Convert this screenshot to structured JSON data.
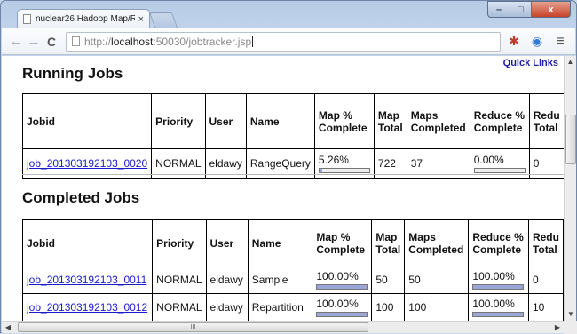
{
  "browser": {
    "tab_title": "nuclear26 Hadoop Map/R",
    "tab_close": "×",
    "url_scheme": "http://",
    "url_host": "localhost",
    "url_path": ":50030/jobtracker.jsp",
    "back": "←",
    "forward": "→",
    "reload": "C",
    "menu": "≡"
  },
  "window": {
    "minimize": "–",
    "maximize": "□",
    "close": "x"
  },
  "page": {
    "quick_links": "Quick Links",
    "running_title": "Running Jobs",
    "completed_title": "Completed Jobs",
    "headers": {
      "jobid": "Jobid",
      "priority": "Priority",
      "user": "User",
      "name": "Name",
      "map_complete": [
        "Map %",
        "Complete"
      ],
      "map_total": [
        "Map",
        "Total"
      ],
      "maps_completed": [
        "Maps",
        "Completed"
      ],
      "reduce_complete": [
        "Reduce %",
        "Complete"
      ],
      "reduce_total": [
        "Redu",
        "Total"
      ]
    },
    "running_jobs": [
      {
        "jobid": "job_201303192103_0020",
        "priority": "NORMAL",
        "user": "eldawy",
        "name": "RangeQuery",
        "map_pct": "5.26%",
        "map_frac": 0.0526,
        "map_total": "722",
        "maps_completed": "37",
        "reduce_pct": "0.00%",
        "reduce_frac": 0,
        "reduce_total": "0"
      }
    ],
    "completed_jobs": [
      {
        "jobid": "job_201303192103_0011",
        "priority": "NORMAL",
        "user": "eldawy",
        "name": "Sample",
        "map_pct": "100.00%",
        "map_frac": 1,
        "map_total": "50",
        "maps_completed": "50",
        "reduce_pct": "100.00%",
        "reduce_frac": 1,
        "reduce_total": "0"
      },
      {
        "jobid": "job_201303192103_0012",
        "priority": "NORMAL",
        "user": "eldawy",
        "name": "Repartition",
        "map_pct": "100.00%",
        "map_frac": 1,
        "map_total": "100",
        "maps_completed": "100",
        "reduce_pct": "100.00%",
        "reduce_frac": 1,
        "reduce_total": "10"
      }
    ]
  },
  "scrollbar": {
    "h_thumb_grip": "III"
  }
}
